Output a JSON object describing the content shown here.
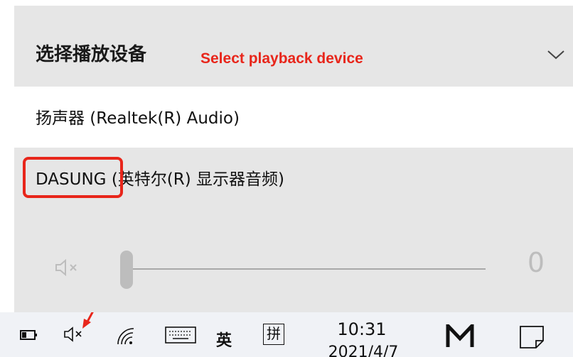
{
  "flyout": {
    "title": "选择播放设备",
    "annotation_label": "Select playback device",
    "devices": [
      {
        "label": "扬声器 (Realtek(R) Audio)",
        "state": "selected"
      },
      {
        "label": "DASUNG (英特尔(R) 显示器音频)",
        "state": "default"
      }
    ],
    "volume": {
      "value": "0",
      "level": 0,
      "muted": true
    }
  },
  "taskbar": {
    "ime_language": "英",
    "ime_mode": "拼",
    "clock": {
      "time": "10:31",
      "date": "2021/4/7"
    }
  },
  "colors": {
    "accent_annotation": "#e8261b",
    "panel_bg": "#e6e6e6",
    "selected_bg": "#ffffff",
    "taskbar_bg": "#f0f2f6"
  },
  "icons": [
    "chevron-down-icon",
    "muted-speaker-icon",
    "battery-icon",
    "wifi-icon",
    "keyboard-icon",
    "app-m-icon",
    "notification-icon",
    "annotation-arrow-icon"
  ]
}
